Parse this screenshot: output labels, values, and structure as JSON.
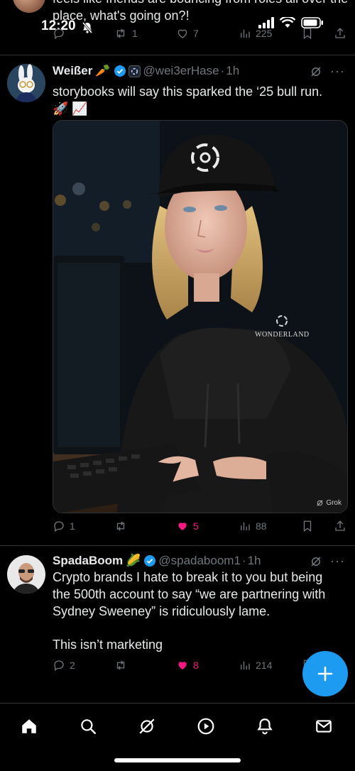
{
  "status_bar": {
    "time": "12:20"
  },
  "top_tweet": {
    "text": "feels like friends are bouncing from roles all over the place, what's going on?!",
    "retweets": "1",
    "likes": "7",
    "views": "225"
  },
  "tweets": [
    {
      "display_name": "Weißer",
      "name_emoji": "🥕",
      "handle": "@wei3erHase",
      "time": "1h",
      "text": "storybooks will say this sparked the ‘25 bull run.",
      "text_emoji": "🚀 📈",
      "media": {
        "cap_logo_text": "",
        "hoodie_text": "WONDERLAND",
        "watermark": "Grok"
      },
      "replies": "1",
      "retweets": "",
      "likes": "5",
      "views": "88",
      "liked": true
    },
    {
      "display_name": "SpadaBoom",
      "name_emoji": "🌽",
      "handle": "@spadaboom1",
      "time": "1h",
      "text": "Crypto brands I hate to break it to you but being the 500th account to say “we are partnering with Sydney Sweeney” is ridiculously lame.",
      "text2": "This isn’t marketing",
      "replies": "2",
      "retweets": "",
      "likes": "8",
      "views": "214",
      "liked": true
    }
  ],
  "colors": {
    "accent": "#1d9bf0",
    "like": "#f91880",
    "muted": "#71767b",
    "text": "#e7e9ea"
  },
  "icons": [
    "reply-icon",
    "retweet-icon",
    "heart-icon",
    "views-icon",
    "bookmark-icon",
    "share-icon",
    "grok-icon",
    "more-icon",
    "home-icon",
    "search-icon",
    "play-icon",
    "bell-icon",
    "mail-icon",
    "plus-icon"
  ]
}
